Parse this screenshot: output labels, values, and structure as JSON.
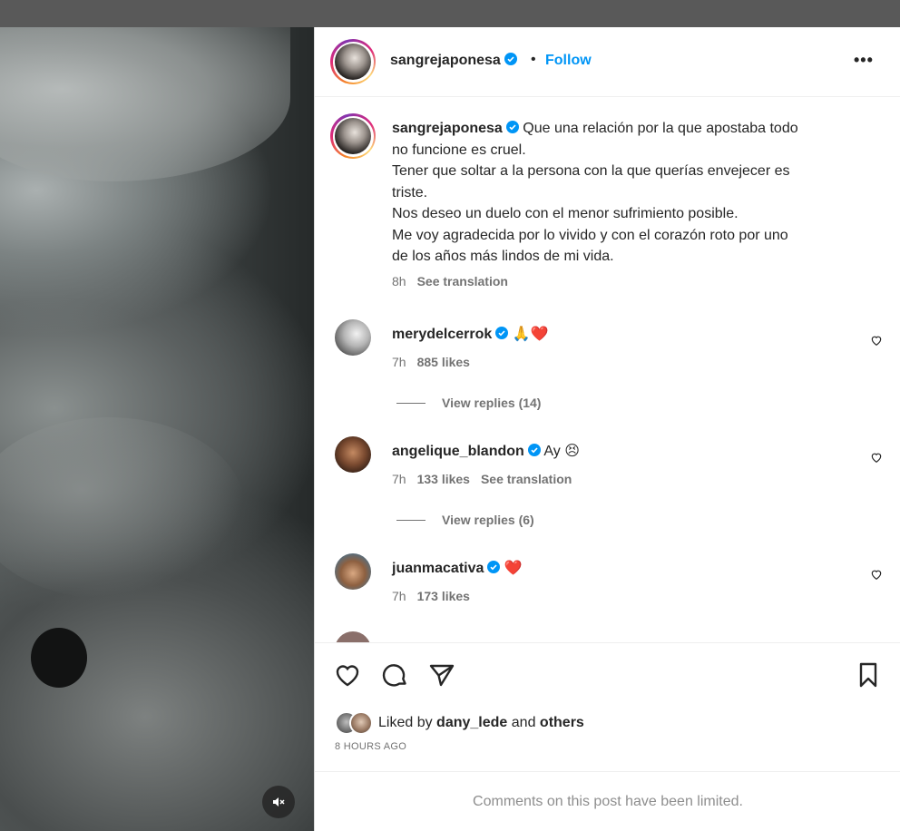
{
  "post": {
    "username": "sangrejaponesa",
    "separator": "•",
    "follow_label": "Follow",
    "more_label": "•••",
    "caption": {
      "text_lines": [
        "Que una relación por la que apostaba todo",
        "no funcione es cruel.",
        "Tener que soltar a la persona con la que querías envejecer es",
        "triste.",
        "Nos deseo un duelo con el menor sufrimiento posible.",
        "Me voy agradecida por lo vivido y con el corazón roto por uno",
        "de los años más lindos de mi vida."
      ],
      "time": "8h",
      "translate_label": "See translation"
    },
    "comments": [
      {
        "username": "merydelcerrok",
        "text": "🙏❤️",
        "time": "7h",
        "likes": "885 likes",
        "translate_label": "",
        "replies_label": "View replies (14)"
      },
      {
        "username": "angelique_blandon",
        "text": "Ay 😣",
        "time": "7h",
        "likes": "133 likes",
        "translate_label": "See translation",
        "replies_label": "View replies (6)"
      },
      {
        "username": "juanmacativa",
        "text": "❤️",
        "time": "7h",
        "likes": "173 likes",
        "translate_label": "",
        "replies_label": ""
      }
    ],
    "liked_by": {
      "prefix": "Liked by",
      "user": "dany_lede",
      "middle": "and",
      "suffix": "others"
    },
    "time_ago": "8 HOURS AGO",
    "comments_limited": "Comments on this post have been limited."
  },
  "colors": {
    "accent": "#0095f6",
    "verified": "#0095f6",
    "text_primary": "#262626",
    "text_secondary": "#737373"
  },
  "icons": {
    "header_more": "more-horizontal-icon",
    "verified": "verified-badge-icon",
    "like": "heart-icon",
    "comment": "comment-bubble-icon",
    "share": "paper-plane-icon",
    "save": "bookmark-icon",
    "mute": "speaker-muted-icon"
  }
}
